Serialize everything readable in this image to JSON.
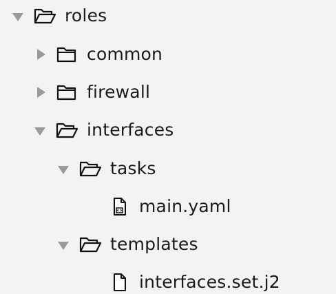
{
  "tree": {
    "nodes": [
      {
        "label": "roles",
        "kind": "folder",
        "expanded": true,
        "icon": "folder-open-icon"
      },
      {
        "label": "common",
        "kind": "folder",
        "expanded": false,
        "icon": "folder-closed-icon"
      },
      {
        "label": "firewall",
        "kind": "folder",
        "expanded": false,
        "icon": "folder-closed-icon"
      },
      {
        "label": "interfaces",
        "kind": "folder",
        "expanded": true,
        "icon": "folder-open-icon"
      },
      {
        "label": "tasks",
        "kind": "folder",
        "expanded": true,
        "icon": "folder-open-icon"
      },
      {
        "label": "main.yaml",
        "kind": "file",
        "icon": "code-file-icon"
      },
      {
        "label": "templates",
        "kind": "folder",
        "expanded": true,
        "icon": "folder-open-icon"
      },
      {
        "label": "interfaces.set.j2",
        "kind": "file",
        "icon": "file-icon"
      }
    ]
  }
}
